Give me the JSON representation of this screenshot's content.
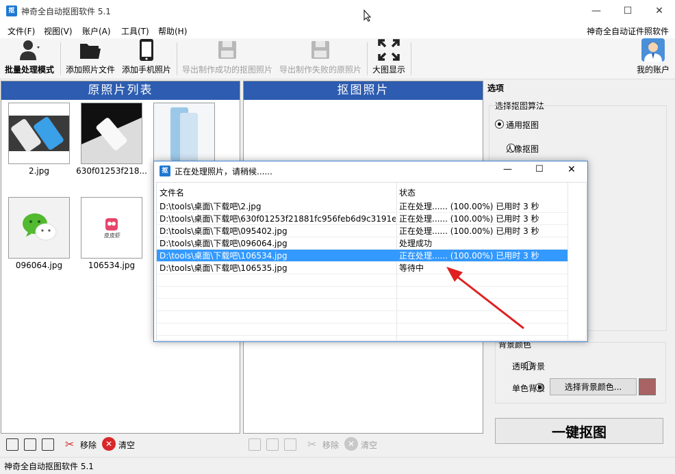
{
  "window": {
    "title": "神奇全自动抠图软件 5.1",
    "logo_text": "抠",
    "controls": {
      "minimize": "—",
      "maximize": "☐",
      "close": "✕"
    }
  },
  "menu": {
    "items": [
      "文件(F)",
      "视图(V)",
      "账户(A)",
      "工具(T)",
      "帮助(H)"
    ],
    "right_link": "神奇全自动证件照软件"
  },
  "toolbar": {
    "batch": "批量处理模式",
    "add_files": "添加照片文件",
    "add_phone": "添加手机照片",
    "export_success": "导出制作成功的抠图照片",
    "export_failed": "导出制作失败的原照片",
    "large_view": "大图显示",
    "account": "我的账户"
  },
  "left_panel": {
    "title": "原照片列表",
    "thumbs": [
      {
        "caption": "2.jpg"
      },
      {
        "caption": "630f01253f218..."
      },
      {
        "caption": ""
      },
      {
        "caption": "096064.jpg"
      },
      {
        "caption": "106534.jpg"
      }
    ],
    "brand_text": "皮皮虾",
    "remove": "移除",
    "clear": "清空"
  },
  "mid_panel": {
    "title": "抠图照片",
    "remove": "移除",
    "clear": "清空"
  },
  "options": {
    "label": "选项",
    "algo_group": "选择抠图算法",
    "algo_general": "通用抠图",
    "algo_portrait": "人像抠图",
    "bg_group": "背景颜色",
    "bg_transparent": "透明背景",
    "bg_solid": "单色背景",
    "choose_color": "选择背景颜色...",
    "swatch_color": "#a86464",
    "one_click": "一键抠图"
  },
  "dialog": {
    "title": "正在处理照片，请稍候......",
    "col_file": "文件名",
    "col_status": "状态",
    "rows": [
      {
        "file": "D:\\tools\\桌面\\下载吧\\2.jpg",
        "status": "正在处理...... (100.00%) 已用时 3 秒"
      },
      {
        "file": "D:\\tools\\桌面\\下载吧\\630f01253f21881fc956feb6d9c3191e...",
        "status": "正在处理...... (100.00%) 已用时 3 秒"
      },
      {
        "file": "D:\\tools\\桌面\\下载吧\\095402.jpg",
        "status": "正在处理...... (100.00%) 已用时 3 秒"
      },
      {
        "file": "D:\\tools\\桌面\\下载吧\\096064.jpg",
        "status": "处理成功"
      },
      {
        "file": "D:\\tools\\桌面\\下载吧\\106534.jpg",
        "status": "正在处理...... (100.00%) 已用时 3 秒"
      },
      {
        "file": "D:\\tools\\桌面\\下载吧\\106535.jpg",
        "status": "等待中"
      }
    ]
  },
  "statusbar": {
    "text": "神奇全自动抠图软件 5.1"
  },
  "colors": {
    "panel_header": "#2d5cb0",
    "selection": "#3399ff",
    "arrow": "#e02020"
  }
}
